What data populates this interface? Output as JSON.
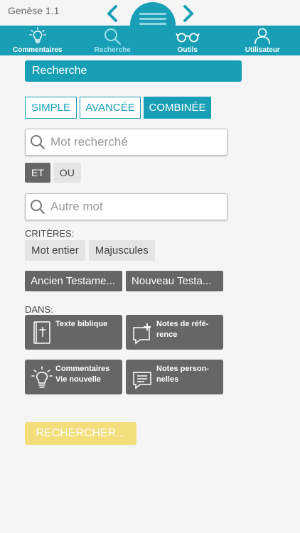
{
  "header": {
    "reference": "Genèse 1.1"
  },
  "tabs": [
    {
      "label": "Commentaires",
      "icon": "lightbulb-icon"
    },
    {
      "label": "Recherche",
      "icon": "search-icon",
      "active": true
    },
    {
      "label": "Outils",
      "icon": "glasses-icon"
    },
    {
      "label": "Utilisateur",
      "icon": "user-icon"
    }
  ],
  "section_title": "Recherche",
  "modes": [
    {
      "label": "SIMPLE"
    },
    {
      "label": "AVANCÉE"
    },
    {
      "label": "COMBINÉE",
      "active": true
    }
  ],
  "search": {
    "primary_placeholder": "Mot recherché",
    "secondary_placeholder": "Autre mot"
  },
  "operators": [
    {
      "label": "ET",
      "active": true
    },
    {
      "label": "OU"
    }
  ],
  "criteria": {
    "label": "CRITÈRES:",
    "options": [
      "Mot entier",
      "Majuscules"
    ]
  },
  "testaments": [
    "Ancien Testame...",
    "Nouveau Testa..."
  ],
  "dans": {
    "label": "DANS:",
    "tiles": [
      {
        "line1": "Texte biblique",
        "line2": "",
        "icon": "bible-icon"
      },
      {
        "line1": "Notes de réfé-",
        "line2": "rence",
        "icon": "note-add-icon"
      },
      {
        "line1": "Commentaires",
        "line2": "Vie nouvelle",
        "icon": "lightbulb-icon"
      },
      {
        "line1": "Notes person-",
        "line2": "nelles",
        "icon": "note-text-icon"
      }
    ]
  },
  "submit_label": "RECHERCHER...",
  "colors": {
    "accent": "#189fb6",
    "tile": "#666666",
    "submit": "#f3de7c"
  }
}
